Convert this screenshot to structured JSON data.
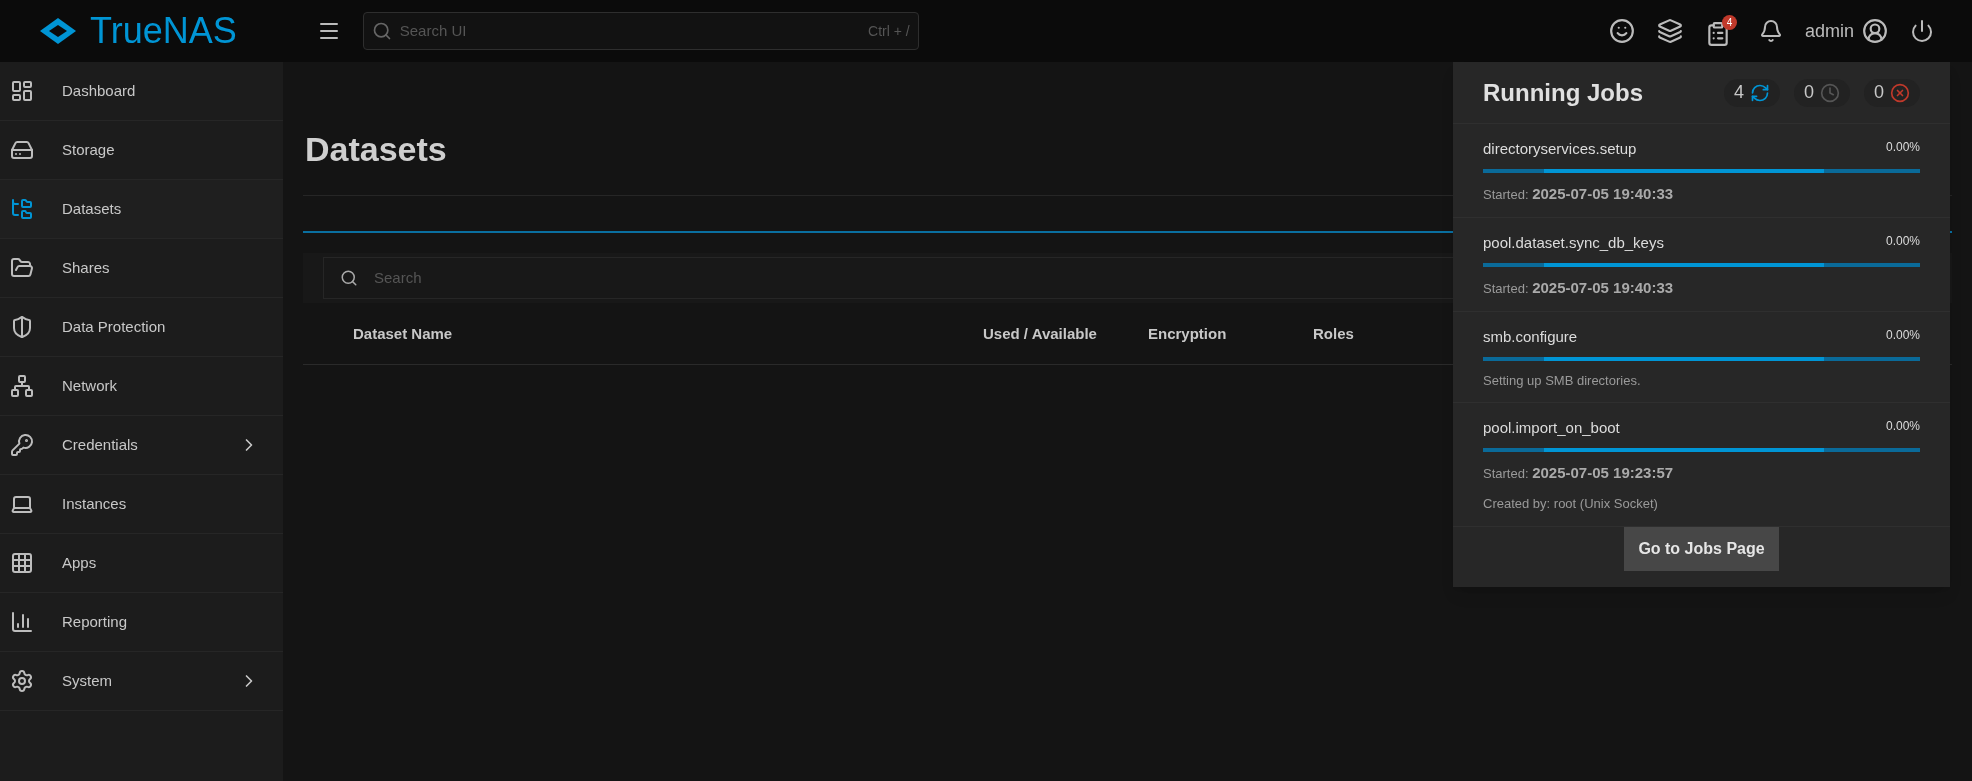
{
  "topbar": {
    "logo": "TrueNAS",
    "search": {
      "placeholder": "Search UI",
      "shortcut": "Ctrl + /"
    },
    "jobs_badge": "4",
    "user": "admin"
  },
  "sidebar": {
    "items": [
      {
        "label": "Dashboard",
        "selected": false,
        "submenu": false
      },
      {
        "label": "Storage",
        "selected": false,
        "submenu": false
      },
      {
        "label": "Datasets",
        "selected": true,
        "submenu": false
      },
      {
        "label": "Shares",
        "selected": false,
        "submenu": false
      },
      {
        "label": "Data Protection",
        "selected": false,
        "submenu": false
      },
      {
        "label": "Network",
        "selected": false,
        "submenu": false
      },
      {
        "label": "Credentials",
        "selected": false,
        "submenu": true
      },
      {
        "label": "Instances",
        "selected": false,
        "submenu": false
      },
      {
        "label": "Apps",
        "selected": false,
        "submenu": false
      },
      {
        "label": "Reporting",
        "selected": false,
        "submenu": false
      },
      {
        "label": "System",
        "selected": false,
        "submenu": true
      }
    ]
  },
  "page": {
    "title": "Datasets",
    "search": {
      "placeholder": "Search"
    },
    "columns": [
      "Dataset Name",
      "Used / Available",
      "Encryption",
      "Roles"
    ]
  },
  "jobs_panel": {
    "title": "Running Jobs",
    "counters": [
      {
        "kind": "running",
        "count": "4"
      },
      {
        "kind": "waiting",
        "count": "0"
      },
      {
        "kind": "failed",
        "count": "0"
      }
    ],
    "jobs": [
      {
        "name": "directoryservices.setup",
        "percent": "0.00%",
        "indeterminate": true,
        "lines": [
          "Started: **2025-07-05 19:40:33**"
        ]
      },
      {
        "name": "pool.dataset.sync_db_keys",
        "percent": "0.00%",
        "indeterminate": true,
        "lines": [
          "Started: **2025-07-05 19:40:33**"
        ]
      },
      {
        "name": "smb.configure",
        "percent": "0.00%",
        "indeterminate": true,
        "lines": [
          "Setting up SMB directories."
        ]
      },
      {
        "name": "pool.import_on_boot",
        "percent": "0.00%",
        "indeterminate": true,
        "lines": [
          "Started: **2025-07-05 19:23:57**",
          "Created by: root (Unix Socket)"
        ]
      }
    ],
    "button": "Go to Jobs Page"
  }
}
